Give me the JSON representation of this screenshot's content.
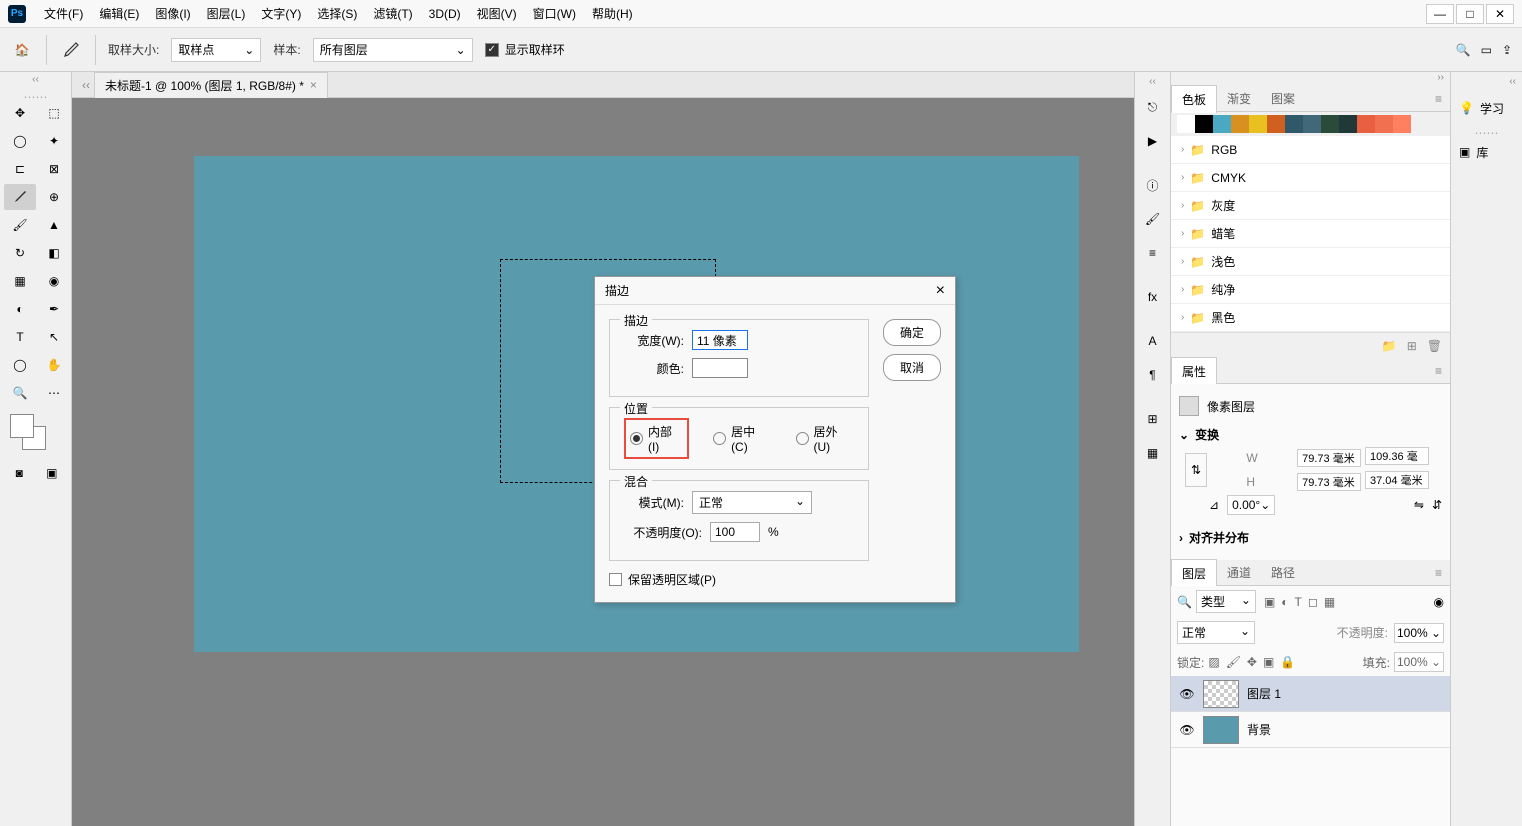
{
  "menubar": {
    "items": [
      "文件(F)",
      "编辑(E)",
      "图像(I)",
      "图层(L)",
      "文字(Y)",
      "选择(S)",
      "滤镜(T)",
      "3D(D)",
      "视图(V)",
      "窗口(W)",
      "帮助(H)"
    ]
  },
  "optionsbar": {
    "sample_size_label": "取样大小:",
    "sample_size_value": "取样点",
    "sample_label": "样本:",
    "sample_value": "所有图层",
    "show_ring": "显示取样环"
  },
  "doctab": {
    "title": "未标题-1 @ 100% (图层 1, RGB/8#) *"
  },
  "dialog": {
    "title": "描边",
    "ok": "确定",
    "cancel": "取消",
    "stroke_group": "描边",
    "width_label": "宽度(W):",
    "width_value": "11 像素",
    "color_label": "颜色:",
    "position_group": "位置",
    "pos_inside": "内部(I)",
    "pos_center": "居中(C)",
    "pos_outside": "居外(U)",
    "blend_group": "混合",
    "mode_label": "模式(M):",
    "mode_value": "正常",
    "opacity_label": "不透明度(O):",
    "opacity_value": "100",
    "opacity_pct": "%",
    "preserve": "保留透明区域(P)"
  },
  "swatches_panel": {
    "tabs": [
      "色板",
      "渐变",
      "图案"
    ],
    "colors": [
      "#ffffff",
      "#000000",
      "#4aa8c2",
      "#d89020",
      "#e8c020",
      "#d06020",
      "#305868",
      "#406878",
      "#2a4a3a",
      "#203838",
      "#e86040",
      "#f07050",
      "#ff8060"
    ],
    "folders": [
      "RGB",
      "CMYK",
      "灰度",
      "蜡笔",
      "浅色",
      "纯净",
      "黑色"
    ]
  },
  "properties": {
    "tab": "属性",
    "pixel_layer": "像素图层",
    "transform": "变换",
    "w_val": "79.73 毫米",
    "h_val": "79.73 毫米",
    "x_val": "109.36 毫",
    "y_val": "37.04 毫米",
    "angle": "0.00°",
    "align": "对齐并分布"
  },
  "layers": {
    "tabs": [
      "图层",
      "通道",
      "路径"
    ],
    "type_filter": "类型",
    "blend_mode": "正常",
    "opacity_label": "不透明度:",
    "opacity_val": "100%",
    "lock_label": "锁定:",
    "fill_label": "填充:",
    "fill_val": "100%",
    "list": [
      {
        "name": "图层 1",
        "selected": true,
        "thumb": "checker"
      },
      {
        "name": "背景",
        "selected": false,
        "thumb": "teal"
      }
    ]
  },
  "far_right": {
    "learn": "学习",
    "library": "库"
  }
}
